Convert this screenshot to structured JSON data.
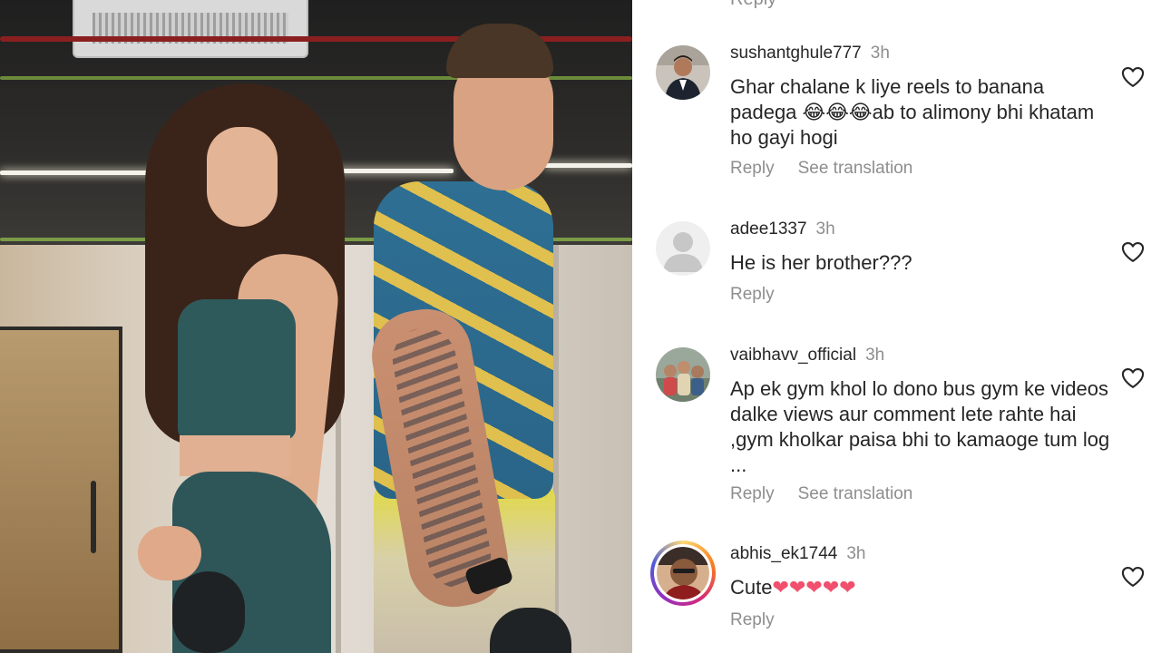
{
  "photo": {
    "alt": "Man and woman posing back to back in a gym holding kettlebells"
  },
  "comments_top_cut": "Reply",
  "comments": [
    {
      "username": "sushantghule777",
      "time": "3h",
      "text": "Ghar chalane k liye reels to banana padega 😂😂😂ab to alimony bhi khatam ho gayi hogi",
      "reply_label": "Reply",
      "translation_label": "See translation",
      "avatar": "man-in-suit-avatar"
    },
    {
      "username": "adee1337",
      "time": "3h",
      "text": "He is her brother???",
      "reply_label": "Reply",
      "avatar": "default-user-avatar"
    },
    {
      "username": "vaibhavv_official",
      "time": "3h",
      "text": "Ap ek gym khol lo dono bus gym ke videos dalke views aur comment lete rahte hai ,gym kholkar paisa bhi to kamaoge tum log ...",
      "reply_label": "Reply",
      "translation_label": "See translation",
      "avatar": "group-photo-avatar"
    },
    {
      "username": "abhis_ek1744",
      "time": "3h",
      "text": "Cute❤❤❤❤❤",
      "reply_label": "Reply",
      "avatar": "story-ring-avatar"
    }
  ],
  "icons": {
    "like": "heart-outline-icon"
  },
  "colors": {
    "text": "#262626",
    "secondary": "#8e8e8e",
    "heart_emoji": "#f0506e"
  }
}
